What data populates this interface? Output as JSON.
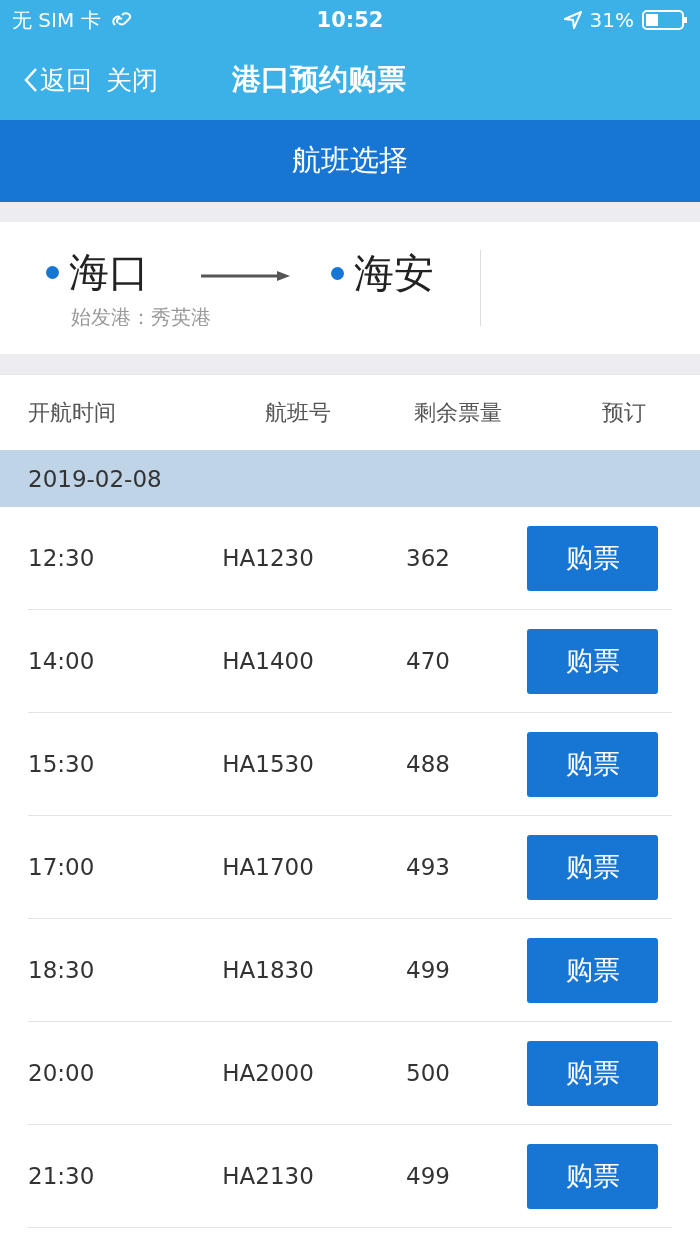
{
  "status_bar": {
    "carrier": "无 SIM 卡",
    "time": "10:52",
    "battery": "31%"
  },
  "nav": {
    "back": "返回",
    "close": "关闭",
    "title": "港口预约购票"
  },
  "section_title": "航班选择",
  "route": {
    "from": "海口",
    "to": "海安",
    "departure_port": "始发港：秀英港"
  },
  "table": {
    "columns": [
      "开航时间",
      "航班号",
      "剩余票量",
      "预订"
    ],
    "date": "2019-02-08",
    "rows": [
      {
        "time": "12:30",
        "flight": "HA1230",
        "remaining": "362",
        "action": "购票"
      },
      {
        "time": "14:00",
        "flight": "HA1400",
        "remaining": "470",
        "action": "购票"
      },
      {
        "time": "15:30",
        "flight": "HA1530",
        "remaining": "488",
        "action": "购票"
      },
      {
        "time": "17:00",
        "flight": "HA1700",
        "remaining": "493",
        "action": "购票"
      },
      {
        "time": "18:30",
        "flight": "HA1830",
        "remaining": "499",
        "action": "购票"
      },
      {
        "time": "20:00",
        "flight": "HA2000",
        "remaining": "500",
        "action": "购票"
      },
      {
        "time": "21:30",
        "flight": "HA2130",
        "remaining": "499",
        "action": "购票"
      }
    ]
  }
}
